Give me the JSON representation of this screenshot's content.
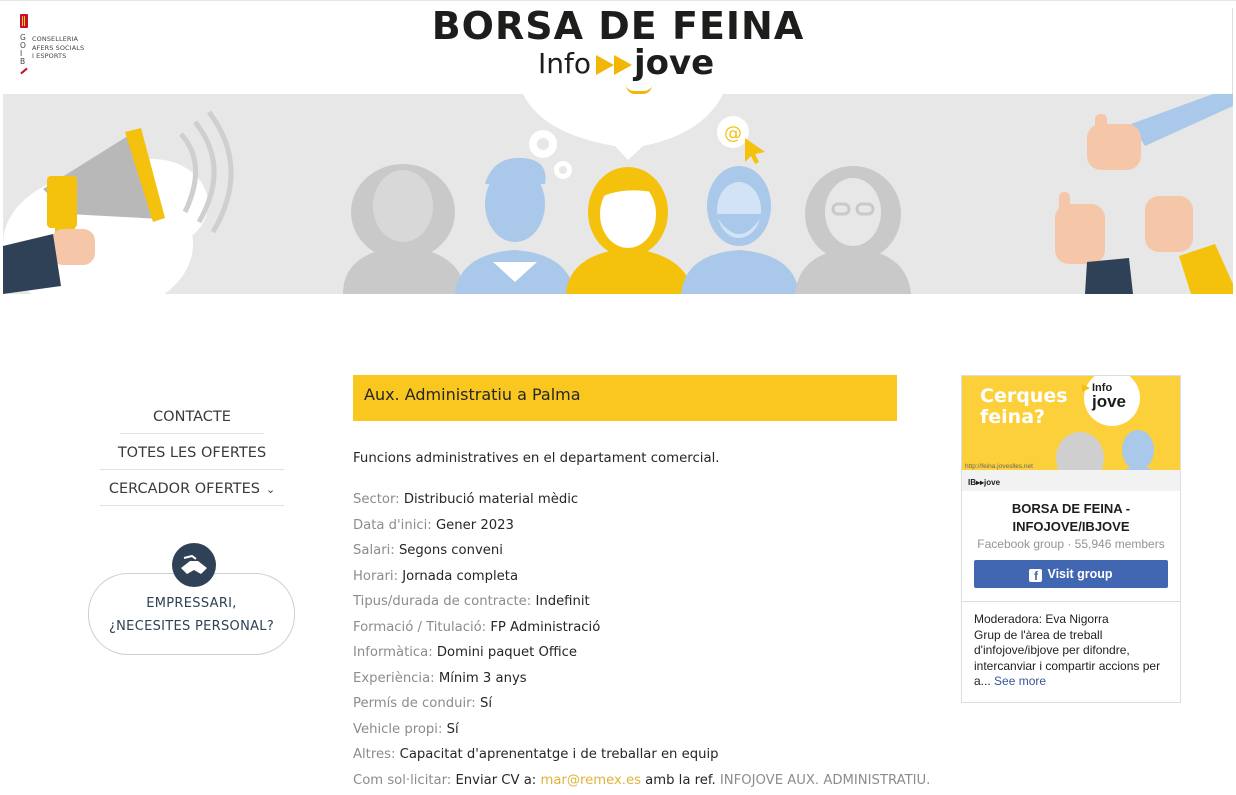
{
  "header": {
    "logo_letters": [
      "G",
      "O",
      "I",
      "B"
    ],
    "logo_text": [
      "CONSELLERIA",
      "AFERS SOCIALS",
      "I ESPORTS"
    ],
    "title": "BORSA DE FEINA",
    "brand_info": "Info",
    "brand_jove": "jove"
  },
  "nav": {
    "items": [
      {
        "label": "CONTACTE"
      },
      {
        "label": "TOTES LES OFERTES"
      },
      {
        "label": "CERCADOR OFERTES"
      }
    ],
    "employer_line1": "EMPRESSARI,",
    "employer_line2": "¿NECESITES PERSONAL?"
  },
  "job": {
    "title": "Aux. Administratiu a Palma",
    "description": "Funcions administratives en el departament comercial.",
    "fields": [
      {
        "label": "Sector:",
        "value": "Distribució material mèdic"
      },
      {
        "label": "Data d'inici:",
        "value": "Gener 2023"
      },
      {
        "label": "Salari:",
        "value": "Segons conveni"
      },
      {
        "label": "Horari:",
        "value": "Jornada completa"
      },
      {
        "label": "Tipus/durada de contracte:",
        "value": "Indefinit"
      },
      {
        "label": "Formació / Titulació:",
        "value": "FP Administració"
      },
      {
        "label": "Informàtica:",
        "value": "Domini paquet Office"
      },
      {
        "label": "Experiència:",
        "value": "Mínim 3 anys"
      },
      {
        "label": "Permís de conduir:",
        "value": "Sí"
      },
      {
        "label": "Vehicle propi:",
        "value": "Sí"
      },
      {
        "label": "Altres:",
        "value": "Capacitat d'aprenentatge i de treballar en equip"
      }
    ],
    "apply": {
      "label": "Com sol·licitar:",
      "prefix": "Enviar CV a:",
      "email": "mar@remex.es",
      "middle": "amb la ref.",
      "reference": "INFOJOVE AUX. ADMINISTRATIU."
    }
  },
  "facebook": {
    "cover_text1": "Cerques",
    "cover_text2": "feina?",
    "cover_brand_info": "Info",
    "cover_brand_jove": "jove",
    "cover_url": "http://feina.joveslles.net",
    "cover_ib": "IB▸▸jove",
    "name_line1": "BORSA DE FEINA -",
    "name_line2": "INFOJOVE/IBJOVE",
    "meta": "Facebook group · 55,946 members",
    "button": "Visit group",
    "desc_line1": "Moderadora: Eva Nigorra",
    "desc_line2": "Grup de l'àrea de treball d'infojove/ibjove per difondre, intercanviar i compartir accions per a...",
    "see_more": "See more"
  },
  "colors": {
    "accent_yellow": "#fac71f",
    "navy": "#2f4156",
    "fb_blue": "#4267b2"
  }
}
